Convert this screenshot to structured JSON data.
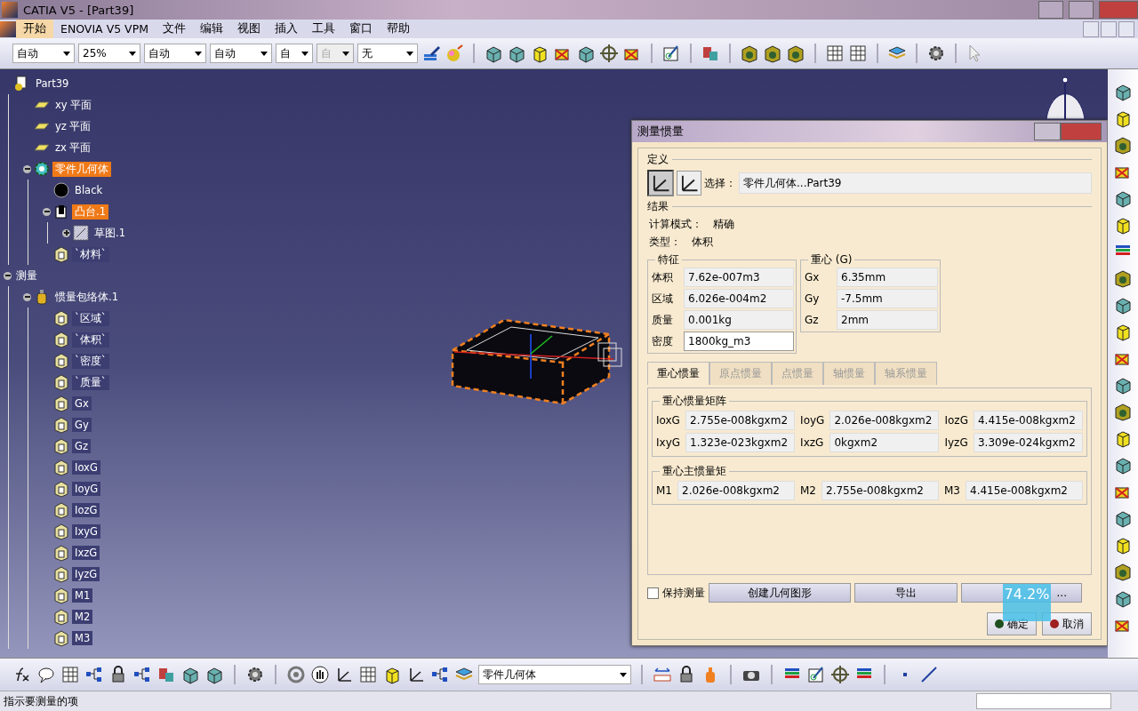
{
  "window": {
    "title": "CATIA V5 - [Part39]"
  },
  "menu": [
    {
      "label": "开始",
      "selected": true
    },
    {
      "label": "ENOVIA V5 VPM",
      "selected": false
    },
    {
      "label": "文件",
      "selected": false
    },
    {
      "label": "编辑",
      "selected": false
    },
    {
      "label": "视图",
      "selected": false
    },
    {
      "label": "插入",
      "selected": false
    },
    {
      "label": "工具",
      "selected": false
    },
    {
      "label": "窗口",
      "selected": false
    },
    {
      "label": "帮助",
      "selected": false
    }
  ],
  "toolbar": {
    "combos": [
      {
        "value": "自动",
        "disabled": false
      },
      {
        "value": "25%",
        "disabled": false
      },
      {
        "value": "自动",
        "disabled": false
      },
      {
        "value": "自动",
        "disabled": false
      },
      {
        "value": "自",
        "disabled": false
      },
      {
        "value": "自",
        "disabled": true
      },
      {
        "value": "无",
        "disabled": false
      }
    ]
  },
  "tree": [
    {
      "label": "Part39",
      "kind": "part",
      "selected": false,
      "children": [
        {
          "label": "xy 平面",
          "kind": "plane",
          "selected": false
        },
        {
          "label": "yz 平面",
          "kind": "plane",
          "selected": false
        },
        {
          "label": "zx 平面",
          "kind": "plane",
          "selected": false
        },
        {
          "label": "零件几何体",
          "kind": "body",
          "selected": true,
          "expanded": true,
          "children": [
            {
              "label": "Black",
              "kind": "ball",
              "selected": false
            },
            {
              "label": "凸台.1",
              "kind": "pad",
              "selected": true,
              "expanded": true,
              "children": [
                {
                  "label": "草图.1",
                  "kind": "sketch",
                  "selected": false,
                  "expanded": false
                }
              ]
            },
            {
              "label": "`材料`",
              "kind": "param",
              "selected": false
            }
          ]
        }
      ]
    },
    {
      "label": "测量",
      "kind": "none",
      "selected": false,
      "expanded": true,
      "children": [
        {
          "label": "惯量包络体.1",
          "kind": "inertia",
          "selected": false,
          "expanded": true,
          "children": [
            {
              "label": "`区域`",
              "kind": "param",
              "selected": false
            },
            {
              "label": "`体积`",
              "kind": "param",
              "selected": false
            },
            {
              "label": "`密度`",
              "kind": "param",
              "selected": false
            },
            {
              "label": "`质量`",
              "kind": "param",
              "selected": false
            },
            {
              "label": "Gx",
              "kind": "param",
              "selected": false
            },
            {
              "label": "Gy",
              "kind": "param",
              "selected": false
            },
            {
              "label": "Gz",
              "kind": "param",
              "selected": false
            },
            {
              "label": "IoxG",
              "kind": "param",
              "selected": false
            },
            {
              "label": "IoyG",
              "kind": "param",
              "selected": false
            },
            {
              "label": "IozG",
              "kind": "param",
              "selected": false
            },
            {
              "label": "IxyG",
              "kind": "param",
              "selected": false
            },
            {
              "label": "IxzG",
              "kind": "param",
              "selected": false
            },
            {
              "label": "IyzG",
              "kind": "param",
              "selected": false
            },
            {
              "label": "M1",
              "kind": "param",
              "selected": false
            },
            {
              "label": "M2",
              "kind": "param",
              "selected": false
            },
            {
              "label": "M3",
              "kind": "param",
              "selected": false
            }
          ]
        }
      ]
    }
  ],
  "dialog": {
    "title": "测量惯量",
    "definition": {
      "heading": "定义",
      "modes": [
        {
          "selected": true
        },
        {
          "selected": false
        }
      ],
      "select_label": "选择：",
      "select_value": "零件几何体...Part39"
    },
    "results": {
      "heading": "结果",
      "lines": [
        {
          "label": "计算模式：",
          "value": "精确"
        },
        {
          "label": "类型：",
          "value": "体积"
        }
      ]
    },
    "properties": {
      "heading": "特征",
      "rows": [
        {
          "label": "体积",
          "value": "7.62e-007m3",
          "editable": false
        },
        {
          "label": "区域",
          "value": "6.026e-004m2",
          "editable": false
        },
        {
          "label": "质量",
          "value": "0.001kg",
          "editable": false
        },
        {
          "label": "密度",
          "value": "1800kg_m3",
          "editable": true
        }
      ]
    },
    "center": {
      "heading": "重心 (G)",
      "rows": [
        {
          "label": "Gx",
          "value": "6.35mm"
        },
        {
          "label": "Gy",
          "value": "-7.5mm"
        },
        {
          "label": "Gz",
          "value": "2mm"
        }
      ]
    },
    "tabs": [
      {
        "label": "重心惯量",
        "selected": true
      },
      {
        "label": "原点惯量",
        "selected": false
      },
      {
        "label": "点惯量",
        "selected": false
      },
      {
        "label": "轴惯量",
        "selected": false
      },
      {
        "label": "轴系惯量",
        "selected": false
      }
    ],
    "matrix": {
      "heading": "重心惯量矩阵",
      "cells": [
        {
          "label": "IoxG",
          "value": "2.755e-008kgxm2"
        },
        {
          "label": "IoyG",
          "value": "2.026e-008kgxm2"
        },
        {
          "label": "IozG",
          "value": "4.415e-008kgxm2"
        },
        {
          "label": "IxyG",
          "value": "1.323e-023kgxm2"
        },
        {
          "label": "IxzG",
          "value": "0kgxm2"
        },
        {
          "label": "IyzG",
          "value": "3.309e-024kgxm2"
        }
      ]
    },
    "principal": {
      "heading": "重心主惯量矩",
      "cells": [
        {
          "label": "M1",
          "value": "2.026e-008kgxm2"
        },
        {
          "label": "M2",
          "value": "2.755e-008kgxm2"
        },
        {
          "label": "M3",
          "value": "4.415e-008kgxm2"
        }
      ]
    },
    "keep": {
      "label": "保持测量",
      "checked": false
    },
    "actions": [
      "创建几何图形",
      "导出",
      "..."
    ],
    "ok": "确定",
    "cancel": "取消"
  },
  "overlay": {
    "text": "74.2%"
  },
  "bottom_toolbar": {
    "combo": "零件几何体"
  },
  "status_bar": {
    "text": "指示要测量的项"
  }
}
